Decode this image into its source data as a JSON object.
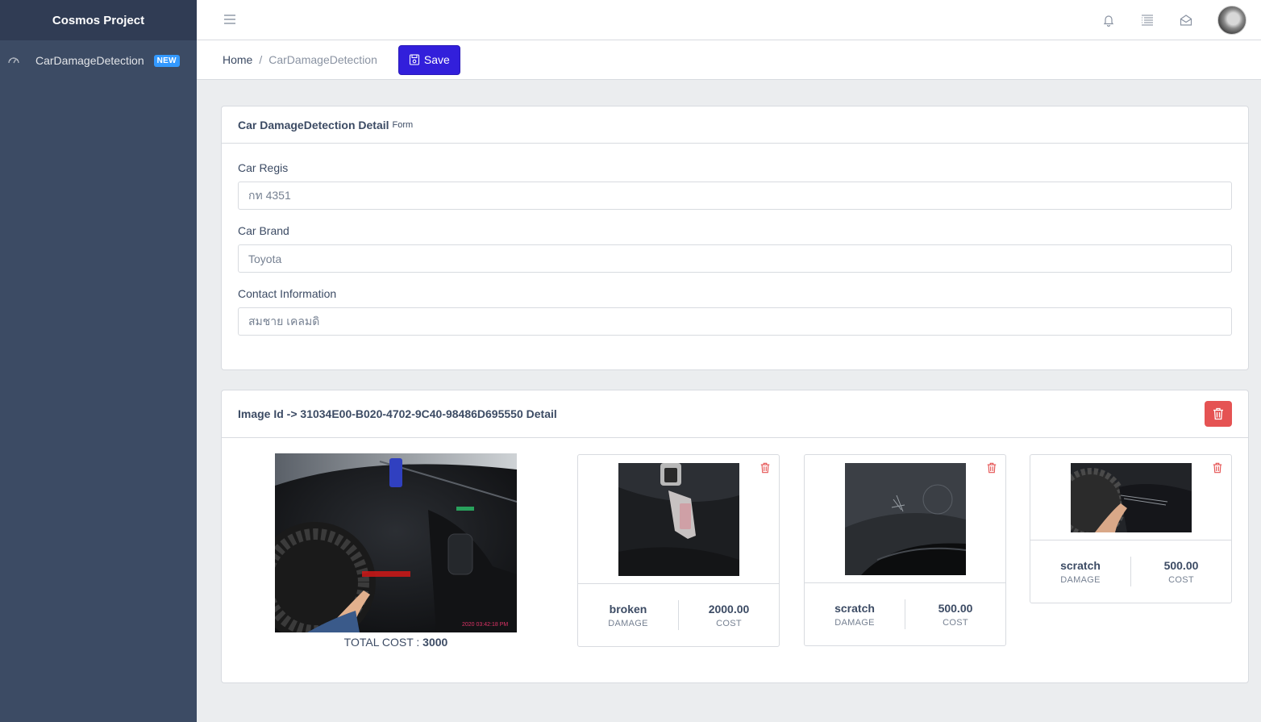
{
  "sidebar": {
    "brand": "Cosmos Project",
    "items": [
      {
        "label": "CarDamageDetection",
        "badge": "NEW",
        "icon": "speedometer-icon"
      }
    ]
  },
  "header": {
    "icons": [
      "hamburger-icon",
      "bell-icon",
      "list-icon",
      "envelope-open-icon"
    ],
    "avatar": "user-avatar"
  },
  "breadcrumb": {
    "home": "Home",
    "separator": "/",
    "current": "CarDamageDetection"
  },
  "toolbar": {
    "save_label": "Save"
  },
  "form": {
    "title": "Car DamageDetection Detail",
    "subtitle": "Form",
    "fields": [
      {
        "label": "Car Regis",
        "value": "กท 4351"
      },
      {
        "label": "Car Brand",
        "value": "Toyota"
      },
      {
        "label": "Contact Information",
        "value": "สมชาย เคลมดิ"
      }
    ]
  },
  "image_detail": {
    "title": "Image Id -> 31034E00-B020-4702-9C40-98486D695550 Detail",
    "total_cost_label": "TOTAL COST :",
    "total_cost_value": "3000",
    "damages": [
      {
        "type": "broken",
        "type_caption": "DAMAGE",
        "cost": "2000.00",
        "cost_caption": "COST"
      },
      {
        "type": "scratch",
        "type_caption": "DAMAGE",
        "cost": "500.00",
        "cost_caption": "COST"
      },
      {
        "type": "scratch",
        "type_caption": "DAMAGE",
        "cost": "500.00",
        "cost_caption": "COST"
      }
    ]
  },
  "colors": {
    "sidebar_bg": "#3c4b64",
    "brand_bg": "#303c54",
    "primary": "#321fdb",
    "danger": "#e55353",
    "info": "#3399ff"
  }
}
